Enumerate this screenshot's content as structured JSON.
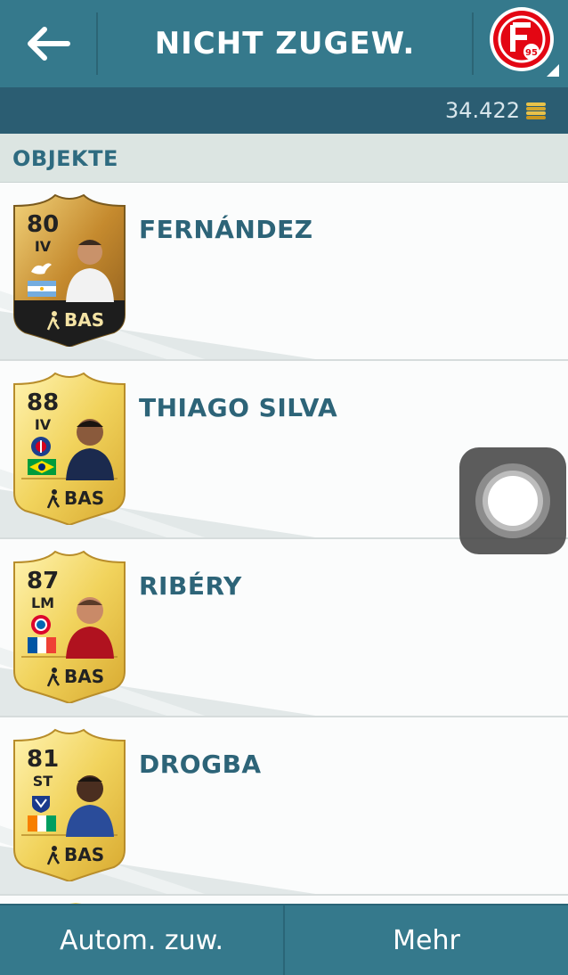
{
  "header": {
    "title": "NICHT ZUGEW.",
    "back_icon": "arrow-left-icon",
    "club_icon": "fortuna-duesseldorf-95-logo",
    "club_badge_text": "95"
  },
  "coins": {
    "amount": "34.422",
    "icon": "coin-stack-icon"
  },
  "section": {
    "label": "OBJEKTE"
  },
  "players": [
    {
      "name": "FERNÁNDEZ",
      "rating": "80",
      "position": "IV",
      "chem_style": "BAS",
      "card": "rare-gold-dark",
      "club": "swansea",
      "nation": "argentina"
    },
    {
      "name": "THIAGO SILVA",
      "rating": "88",
      "position": "IV",
      "chem_style": "BAS",
      "card": "gold",
      "club": "psg",
      "nation": "brazil"
    },
    {
      "name": "RIBÉRY",
      "rating": "87",
      "position": "LM",
      "chem_style": "BAS",
      "card": "gold",
      "club": "bayern",
      "nation": "france"
    },
    {
      "name": "DROGBA",
      "rating": "81",
      "position": "ST",
      "chem_style": "BAS",
      "card": "gold",
      "club": "montreal-impact",
      "nation": "ivory-coast"
    }
  ],
  "bottom": {
    "auto_assign": "Autom. zuw.",
    "more": "Mehr"
  },
  "colors": {
    "header": "#35798c",
    "coinbar": "#2b5d72",
    "accent_text": "#2d6478",
    "section_bg": "#dce5e2"
  }
}
